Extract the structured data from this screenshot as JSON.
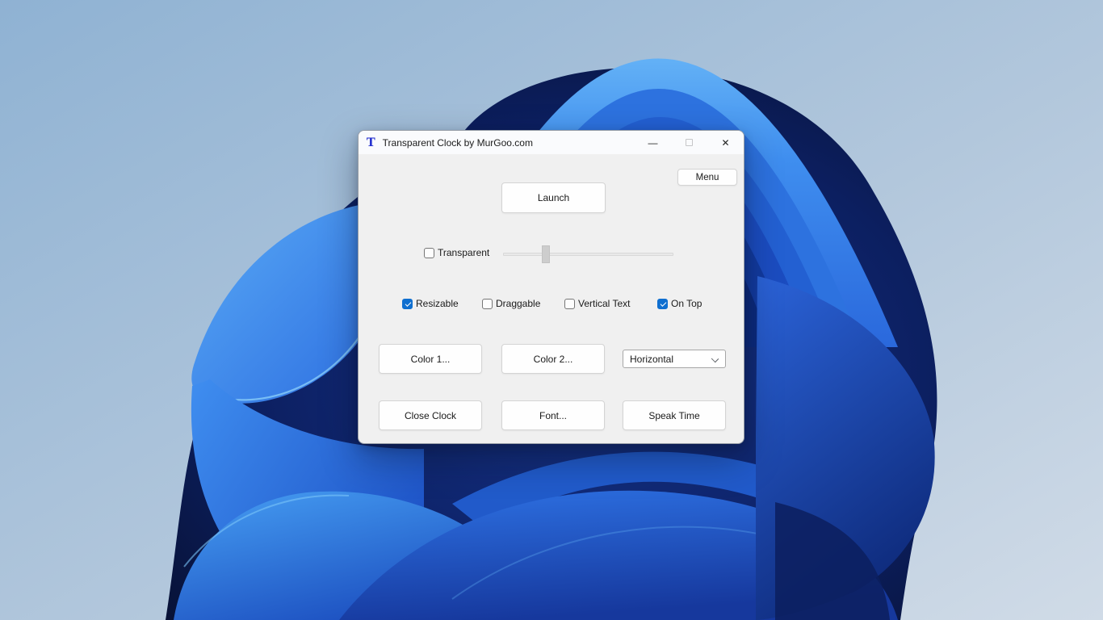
{
  "desktop": {
    "wallpaper_name": "windows-11-bloom"
  },
  "window": {
    "title": "Transparent Clock by MurGoo.com",
    "app_icon_glyph": "T",
    "caption": {
      "minimize_glyph": "—",
      "close_glyph": "✕"
    }
  },
  "toolbar": {
    "menu_label": "Menu"
  },
  "main": {
    "launch_label": "Launch",
    "transparency": {
      "label": "Transparent",
      "checked": false,
      "slider_pct": 25,
      "slider_left": "25%"
    },
    "options": [
      {
        "label": "Resizable",
        "checked": true
      },
      {
        "label": "Draggable",
        "checked": false
      },
      {
        "label": "Vertical Text",
        "checked": false
      },
      {
        "label": "On Top",
        "checked": true
      }
    ],
    "orientation": {
      "value": "Horizontal"
    },
    "buttons": {
      "color1": "Color 1...",
      "color2": "Color 2...",
      "close_clock": "Close Clock",
      "font": "Font...",
      "speak_time": "Speak Time"
    }
  },
  "colors": {
    "checkbox_accent": "#0f6fd0",
    "window_bg": "#f0f0f0",
    "titlebar_bg": "#fafbfd",
    "bloom_bright": "#3f8eef",
    "bloom_dark": "#081238",
    "sky_top": "#8fb2d3",
    "sky_bottom": "#cdd9e6"
  }
}
